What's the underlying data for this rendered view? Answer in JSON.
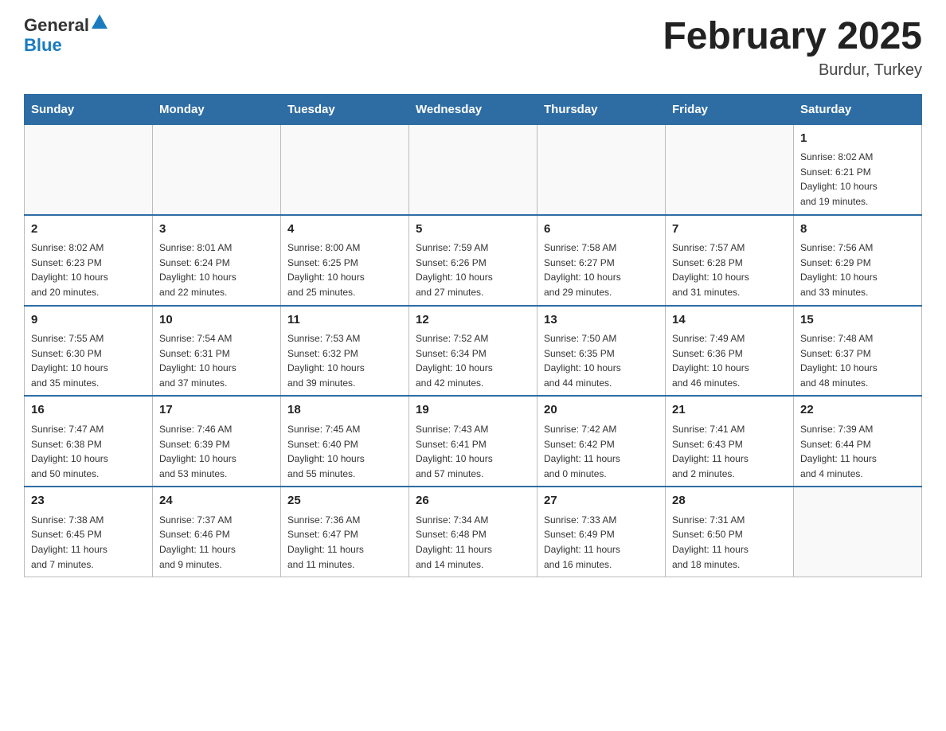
{
  "header": {
    "logo_general": "General",
    "logo_blue": "Blue",
    "month_title": "February 2025",
    "location": "Burdur, Turkey"
  },
  "weekdays": [
    "Sunday",
    "Monday",
    "Tuesday",
    "Wednesday",
    "Thursday",
    "Friday",
    "Saturday"
  ],
  "weeks": [
    [
      {
        "day": "",
        "info": ""
      },
      {
        "day": "",
        "info": ""
      },
      {
        "day": "",
        "info": ""
      },
      {
        "day": "",
        "info": ""
      },
      {
        "day": "",
        "info": ""
      },
      {
        "day": "",
        "info": ""
      },
      {
        "day": "1",
        "info": "Sunrise: 8:02 AM\nSunset: 6:21 PM\nDaylight: 10 hours\nand 19 minutes."
      }
    ],
    [
      {
        "day": "2",
        "info": "Sunrise: 8:02 AM\nSunset: 6:23 PM\nDaylight: 10 hours\nand 20 minutes."
      },
      {
        "day": "3",
        "info": "Sunrise: 8:01 AM\nSunset: 6:24 PM\nDaylight: 10 hours\nand 22 minutes."
      },
      {
        "day": "4",
        "info": "Sunrise: 8:00 AM\nSunset: 6:25 PM\nDaylight: 10 hours\nand 25 minutes."
      },
      {
        "day": "5",
        "info": "Sunrise: 7:59 AM\nSunset: 6:26 PM\nDaylight: 10 hours\nand 27 minutes."
      },
      {
        "day": "6",
        "info": "Sunrise: 7:58 AM\nSunset: 6:27 PM\nDaylight: 10 hours\nand 29 minutes."
      },
      {
        "day": "7",
        "info": "Sunrise: 7:57 AM\nSunset: 6:28 PM\nDaylight: 10 hours\nand 31 minutes."
      },
      {
        "day": "8",
        "info": "Sunrise: 7:56 AM\nSunset: 6:29 PM\nDaylight: 10 hours\nand 33 minutes."
      }
    ],
    [
      {
        "day": "9",
        "info": "Sunrise: 7:55 AM\nSunset: 6:30 PM\nDaylight: 10 hours\nand 35 minutes."
      },
      {
        "day": "10",
        "info": "Sunrise: 7:54 AM\nSunset: 6:31 PM\nDaylight: 10 hours\nand 37 minutes."
      },
      {
        "day": "11",
        "info": "Sunrise: 7:53 AM\nSunset: 6:32 PM\nDaylight: 10 hours\nand 39 minutes."
      },
      {
        "day": "12",
        "info": "Sunrise: 7:52 AM\nSunset: 6:34 PM\nDaylight: 10 hours\nand 42 minutes."
      },
      {
        "day": "13",
        "info": "Sunrise: 7:50 AM\nSunset: 6:35 PM\nDaylight: 10 hours\nand 44 minutes."
      },
      {
        "day": "14",
        "info": "Sunrise: 7:49 AM\nSunset: 6:36 PM\nDaylight: 10 hours\nand 46 minutes."
      },
      {
        "day": "15",
        "info": "Sunrise: 7:48 AM\nSunset: 6:37 PM\nDaylight: 10 hours\nand 48 minutes."
      }
    ],
    [
      {
        "day": "16",
        "info": "Sunrise: 7:47 AM\nSunset: 6:38 PM\nDaylight: 10 hours\nand 50 minutes."
      },
      {
        "day": "17",
        "info": "Sunrise: 7:46 AM\nSunset: 6:39 PM\nDaylight: 10 hours\nand 53 minutes."
      },
      {
        "day": "18",
        "info": "Sunrise: 7:45 AM\nSunset: 6:40 PM\nDaylight: 10 hours\nand 55 minutes."
      },
      {
        "day": "19",
        "info": "Sunrise: 7:43 AM\nSunset: 6:41 PM\nDaylight: 10 hours\nand 57 minutes."
      },
      {
        "day": "20",
        "info": "Sunrise: 7:42 AM\nSunset: 6:42 PM\nDaylight: 11 hours\nand 0 minutes."
      },
      {
        "day": "21",
        "info": "Sunrise: 7:41 AM\nSunset: 6:43 PM\nDaylight: 11 hours\nand 2 minutes."
      },
      {
        "day": "22",
        "info": "Sunrise: 7:39 AM\nSunset: 6:44 PM\nDaylight: 11 hours\nand 4 minutes."
      }
    ],
    [
      {
        "day": "23",
        "info": "Sunrise: 7:38 AM\nSunset: 6:45 PM\nDaylight: 11 hours\nand 7 minutes."
      },
      {
        "day": "24",
        "info": "Sunrise: 7:37 AM\nSunset: 6:46 PM\nDaylight: 11 hours\nand 9 minutes."
      },
      {
        "day": "25",
        "info": "Sunrise: 7:36 AM\nSunset: 6:47 PM\nDaylight: 11 hours\nand 11 minutes."
      },
      {
        "day": "26",
        "info": "Sunrise: 7:34 AM\nSunset: 6:48 PM\nDaylight: 11 hours\nand 14 minutes."
      },
      {
        "day": "27",
        "info": "Sunrise: 7:33 AM\nSunset: 6:49 PM\nDaylight: 11 hours\nand 16 minutes."
      },
      {
        "day": "28",
        "info": "Sunrise: 7:31 AM\nSunset: 6:50 PM\nDaylight: 11 hours\nand 18 minutes."
      },
      {
        "day": "",
        "info": ""
      }
    ]
  ]
}
